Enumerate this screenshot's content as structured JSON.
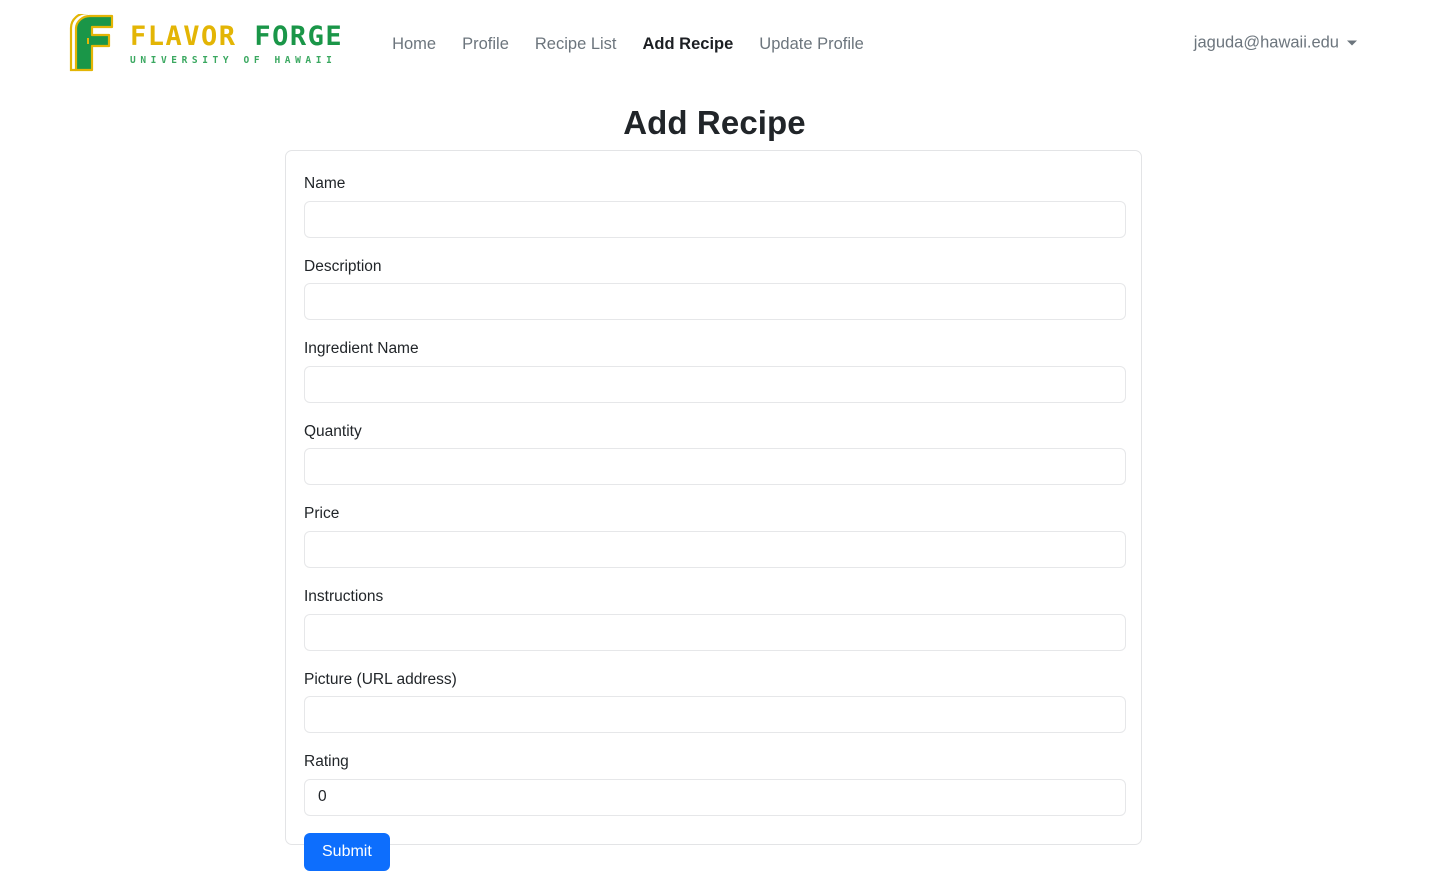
{
  "navbar": {
    "brand": {
      "logo_icon": "flavor-forge-f-monogram-icon",
      "word_primary": "FLAVOR",
      "word_secondary": "FORGE",
      "subtitle": "UNIVERSITY OF HAWAII",
      "color_gold": "#e3b505",
      "color_green": "#1a9648"
    },
    "links": [
      {
        "label": "Home",
        "active": false
      },
      {
        "label": "Profile",
        "active": false
      },
      {
        "label": "Recipe List",
        "active": false
      },
      {
        "label": "Add Recipe",
        "active": true
      },
      {
        "label": "Update Profile",
        "active": false
      }
    ],
    "user": {
      "email": "jaguda@hawaii.edu",
      "caret_icon": "chevron-down-icon"
    }
  },
  "main": {
    "title": "Add Recipe",
    "form": {
      "fields": [
        {
          "label": "Name",
          "value": "",
          "placeholder": ""
        },
        {
          "label": "Description",
          "value": "",
          "placeholder": ""
        },
        {
          "label": "Ingredient Name",
          "value": "",
          "placeholder": ""
        },
        {
          "label": "Quantity",
          "value": "",
          "placeholder": ""
        },
        {
          "label": "Price",
          "value": "",
          "placeholder": ""
        },
        {
          "label": "Instructions",
          "value": "",
          "placeholder": ""
        },
        {
          "label": "Picture (URL address)",
          "value": "",
          "placeholder": ""
        },
        {
          "label": "Rating",
          "value": "0",
          "placeholder": ""
        }
      ],
      "submit_label": "Submit",
      "submit_color": "#0d6efd"
    }
  }
}
